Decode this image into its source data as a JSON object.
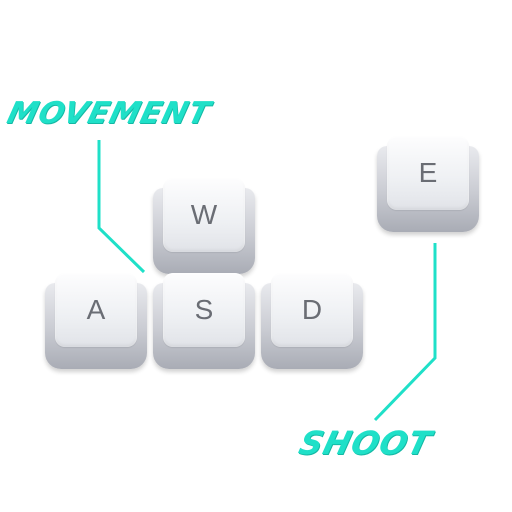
{
  "labels": {
    "movement": "MOVEMENT",
    "shoot": "SHOOT"
  },
  "keys": {
    "w": "W",
    "a": "A",
    "s": "S",
    "d": "D",
    "e": "E"
  },
  "colors": {
    "accent": "#1fe0c8",
    "key_letter": "#6a6d74"
  }
}
